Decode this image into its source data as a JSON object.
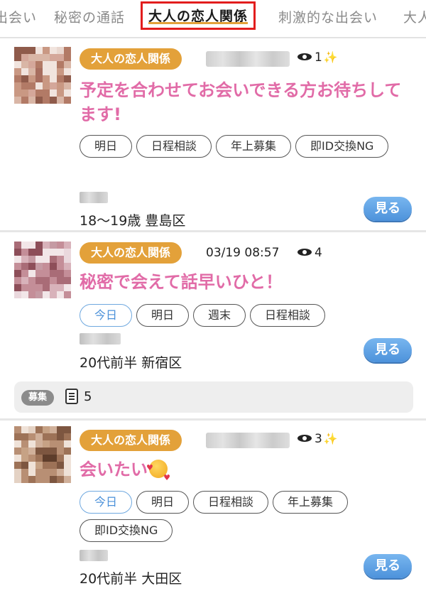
{
  "tabs": [
    {
      "label": "出会い"
    },
    {
      "label": "秘密の通話"
    },
    {
      "label": "大人の恋人関係"
    },
    {
      "label": "刺激的な出会い"
    },
    {
      "label": "大人"
    }
  ],
  "posts": [
    {
      "category": "大人の恋人関係",
      "views": "1",
      "title": "予定を合わせてお会いできる方お待ちしてます!",
      "chips": [
        "明日",
        "日程相談",
        "年上募集",
        "即ID交換NG"
      ],
      "meta": "18〜19歳 豊島区",
      "button": "見る"
    },
    {
      "category": "大人の恋人関係",
      "datetime": "03/19 08:57",
      "views": "4",
      "title": "秘密で会えて話早いひと！",
      "chips": [
        "今日",
        "明日",
        "週末",
        "日程相談"
      ],
      "meta": "20代前半 新宿区",
      "button": "見る"
    },
    {
      "category": "大人の恋人関係",
      "views": "3",
      "title": "会いたい",
      "chips": [
        "今日",
        "明日",
        "日程相談",
        "年上募集",
        "即ID交換NG"
      ],
      "meta": "20代前半 大田区",
      "button": "見る"
    }
  ],
  "recruit": {
    "badge": "募集",
    "count": "5"
  },
  "icons": {
    "views": "eye-icon",
    "new": "sparkle-icon",
    "recruit": "memo-icon",
    "title_emoji": "smiling-face-with-hearts-icon"
  },
  "colors": {
    "category_badge": "#e3a13a",
    "title": "#e16ba7",
    "button": "#5b9fe3",
    "active_tab_border": "#e21d1d",
    "today_chip": "#4a90d9"
  }
}
